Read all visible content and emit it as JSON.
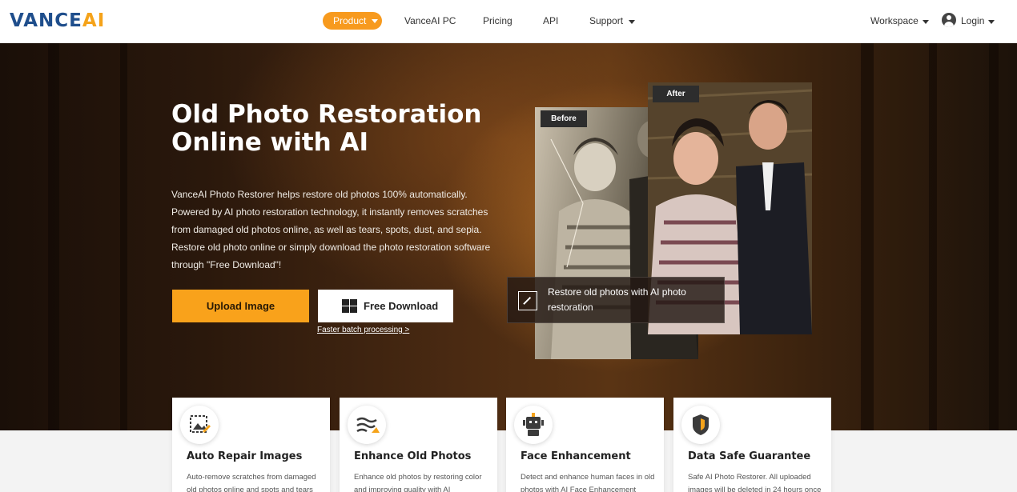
{
  "header": {
    "logo_main": "VANCE",
    "logo_ai": "AI",
    "nav": {
      "product": "Product",
      "vanceai_pc": "VanceAI PC",
      "pricing": "Pricing",
      "api": "API",
      "support": "Support",
      "workspace": "Workspace",
      "login": "Login"
    }
  },
  "hero": {
    "title_line1": "Old Photo Restoration",
    "title_line2": "Online with AI",
    "description": "VanceAI Photo Restorer helps restore old photos 100% automatically. Powered by AI photo restoration technology, it instantly removes scratches from damaged old photos online, as well as tears, spots, dust, and sepia. Restore old photo online or simply download the photo restoration software through \"Free Download\"!",
    "upload_label": "Upload Image",
    "download_label": "Free Download",
    "batch_link": "Faster batch processing >",
    "before_tag": "Before",
    "after_tag": "After",
    "caption": "Restore old photos with AI photo restoration"
  },
  "features": [
    {
      "title": "Auto Repair Images",
      "desc": "Auto-remove scratches from damaged old photos online and spots and tears",
      "icon": "auto-repair-icon"
    },
    {
      "title": "Enhance Old Photos",
      "desc": "Enhance old photos by restoring color and improving quality with AI",
      "icon": "enhance-icon"
    },
    {
      "title": "Face Enhancement",
      "desc": "Detect and enhance human faces in old photos with AI Face Enhancement",
      "icon": "face-robot-icon"
    },
    {
      "title": "Data Safe Guarantee",
      "desc": "Safe AI Photo Restorer. All uploaded images will be deleted in 24 hours once",
      "icon": "shield-icon"
    }
  ],
  "colors": {
    "accent": "#f79a1e",
    "logo_blue": "#1f4e8c"
  }
}
